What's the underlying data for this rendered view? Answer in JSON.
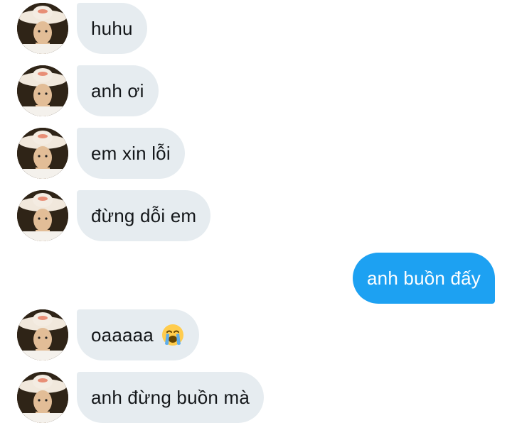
{
  "messages": [
    {
      "sender": "other",
      "text": "huhu"
    },
    {
      "sender": "other",
      "text": "anh ơi"
    },
    {
      "sender": "other",
      "text": "em xin lỗi"
    },
    {
      "sender": "other",
      "text": "đừng dỗi em"
    },
    {
      "sender": "self",
      "text": "anh buồn đấy"
    },
    {
      "sender": "other",
      "text": "oaaaaa",
      "emoji": "loudly-crying-face-emoji"
    },
    {
      "sender": "other",
      "text": "anh đừng buồn mà"
    }
  ],
  "colors": {
    "incoming_bubble": "#e6ecf0",
    "outgoing_bubble": "#1da1f2",
    "incoming_text": "#14171a",
    "outgoing_text": "#ffffff"
  },
  "icons": {
    "avatar": "contact-avatar-photo",
    "emoji": "loudly-crying-face-emoji"
  }
}
